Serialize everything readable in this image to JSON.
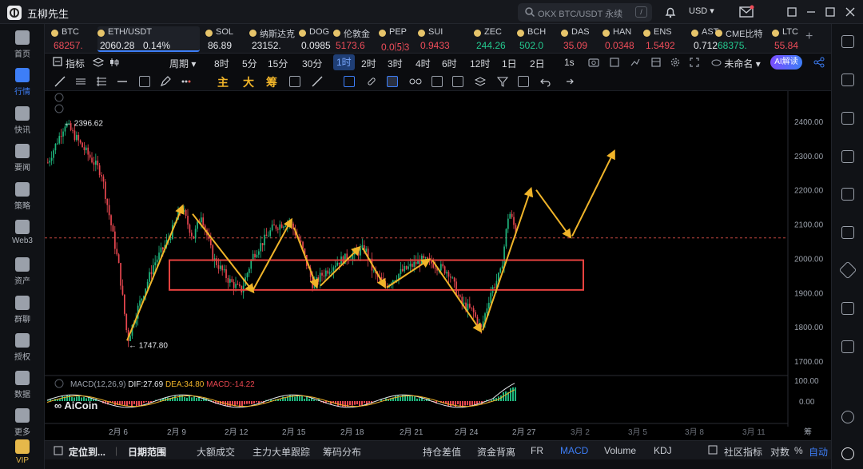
{
  "app": {
    "name": "五柳先生",
    "logo_text": "aicoin"
  },
  "search": {
    "placeholder": "OKX BTC/USDT 永续",
    "shortcut": "/"
  },
  "currency": "USD",
  "left_nav": [
    {
      "label": "首页",
      "icon": "home-icon"
    },
    {
      "label": "行情",
      "icon": "market-icon",
      "active": true
    },
    {
      "label": "快讯",
      "icon": "flash-icon"
    },
    {
      "label": "要闻",
      "icon": "news-icon"
    },
    {
      "label": "策略",
      "icon": "strategy-icon"
    },
    {
      "label": "Web3",
      "icon": "web3-icon"
    },
    {
      "label": "资产",
      "icon": "asset-icon"
    },
    {
      "label": "群聊",
      "icon": "chat-icon"
    },
    {
      "label": "授权",
      "icon": "key-icon"
    },
    {
      "label": "数据",
      "icon": "data-icon"
    },
    {
      "label": "更多",
      "icon": "more-icon"
    },
    {
      "label": "VIP",
      "icon": "vip-icon"
    }
  ],
  "tickers": [
    {
      "name": "BTC",
      "price": "68257.",
      "color": "down"
    },
    {
      "name": "ETH/USDT",
      "price": "2060.28",
      "change": "0.14%",
      "color": "white",
      "active": true
    },
    {
      "name": "SOL",
      "price": "86.89",
      "color": "white"
    },
    {
      "name": "纳斯达克",
      "price": "23152.",
      "color": "white"
    },
    {
      "name": "DOG",
      "price": "0.0985",
      "color": "white"
    },
    {
      "name": "伦敦金",
      "price": "5173.6",
      "color": "down"
    },
    {
      "name": "PEP",
      "price": "0.0⑸3",
      "color": "down"
    },
    {
      "name": "SUI",
      "price": "0.9433",
      "color": "down"
    },
    {
      "name": "ZEC",
      "price": "244.26",
      "color": "up"
    },
    {
      "name": "BCH",
      "price": "502.0",
      "color": "up"
    },
    {
      "name": "DAS",
      "price": "35.09",
      "color": "down"
    },
    {
      "name": "HAN",
      "price": "0.0348",
      "color": "down"
    },
    {
      "name": "ENS",
      "price": "1.5492",
      "color": "down"
    },
    {
      "name": "AST",
      "price": "0.712",
      "color": "white"
    },
    {
      "name": "CME比特",
      "price": "68375.",
      "color": "up"
    },
    {
      "name": "LTC",
      "price": "55.84",
      "color": "down"
    }
  ],
  "toolbar1": {
    "indicator_label": "指标",
    "period_label": "周期",
    "periods": [
      "8时",
      "5分",
      "15分",
      "30分",
      "1时",
      "2时",
      "3时",
      "4时",
      "6时",
      "12时",
      "1日",
      "2日",
      "1s"
    ],
    "active_period": "1时",
    "layout_name": "未命名",
    "ai_label": "AI解读"
  },
  "toolbar2": {
    "chars": [
      "主",
      "大",
      "筹"
    ]
  },
  "chart_data": {
    "type": "candlestick",
    "pair": "ETH/USDT",
    "y_ticks": [
      2400,
      2300,
      2200,
      2100,
      2000,
      1900,
      1800,
      1700
    ],
    "y_tick_labels": [
      "2400.00",
      "2300.00",
      "2200.00",
      "2100.00",
      "2000.00",
      "1900.00",
      "1800.00",
      "1700.00"
    ],
    "x_tick_labels": [
      "2月 6",
      "2月 9",
      "2月 12",
      "2月 15",
      "2月 18",
      "2月 21",
      "2月 24",
      "2月 27",
      "3月 2",
      "3月 5",
      "3月 8",
      "3月 11"
    ],
    "max_label": "2396.62",
    "min_label": "1747.80",
    "current_price": 2060,
    "range_box": {
      "low": 1908,
      "high": 1995
    },
    "macd": {
      "label": "MACD(12,26,9)",
      "dif_label": "DIF:27.69",
      "dea_label": "DEA:34.80",
      "macd_label": "MACD:-14.22",
      "y_tick_labels": [
        "100.00",
        "0.00"
      ]
    },
    "watermark": "AiCoin",
    "note": "yellow arrows annotate zig-zag path, projected up to ~2310"
  },
  "bottom_bar": {
    "locate": "定位到...",
    "date_range": "日期范围",
    "tabs": [
      "大额成交",
      "主力大单跟踪",
      "筹码分布",
      "持仓差值",
      "资金背离",
      "FR",
      "MACD",
      "Volume",
      "KDJ"
    ],
    "active_tab": "MACD",
    "community": "社区指标",
    "log_label": "对数",
    "pct_label": "%",
    "auto_label": "自动"
  },
  "chart_side_label": "筹"
}
